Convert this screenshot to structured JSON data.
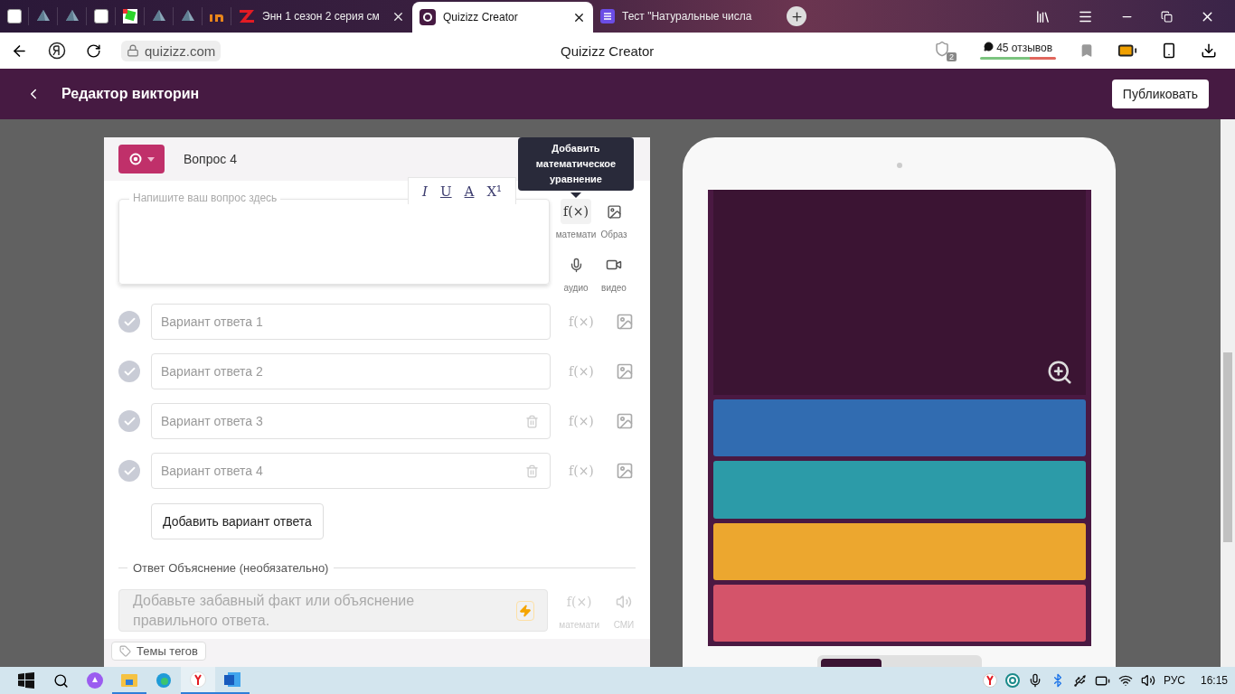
{
  "browser": {
    "tabs": [
      {
        "kind": "page",
        "selected": false
      },
      {
        "kind": "pyramid",
        "selected": false
      },
      {
        "kind": "pyramid",
        "selected": false
      },
      {
        "kind": "page",
        "selected": false
      },
      {
        "kind": "green",
        "selected": false
      },
      {
        "kind": "pyramid",
        "selected": false
      },
      {
        "kind": "pyramid",
        "selected": false
      },
      {
        "kind": "orange",
        "selected": false
      },
      {
        "kind": "site",
        "label": "Энн 1 сезон 2 серия см",
        "selected": false
      },
      {
        "kind": "site",
        "label": "Quizizz Creator",
        "selected": true
      },
      {
        "kind": "site",
        "label": "Тест \"Натуральные числа",
        "selected": false
      }
    ],
    "url": "quizizz.com",
    "page_title": "Quizizz Creator",
    "shield_count": "2",
    "reviews": "45 отзывов"
  },
  "header": {
    "title": "Редактор викторин",
    "publish": "Публиковать"
  },
  "question": {
    "number": "Вопрос 4",
    "tooltip": "Добавить математическое уравнение",
    "format_buttons": [
      "I",
      "U",
      "A",
      "X¹"
    ],
    "placeholder": "Напишите ваш вопрос здесь",
    "media": [
      {
        "kind": "math",
        "glyph": "f(×)",
        "label": "математи"
      },
      {
        "kind": "image",
        "label": "Образ"
      },
      {
        "kind": "audio",
        "label": "аудио"
      },
      {
        "kind": "video",
        "label": "видео"
      }
    ]
  },
  "options": [
    {
      "placeholder": "Вариант ответа 1",
      "correct": false,
      "deletable": false,
      "math_glyph": "f(×)"
    },
    {
      "placeholder": "Вариант ответа 2",
      "correct": false,
      "deletable": false,
      "math_glyph": "f(×)"
    },
    {
      "placeholder": "Вариант ответа 3",
      "correct": false,
      "deletable": true,
      "math_glyph": "f(×)"
    },
    {
      "placeholder": "Вариант ответа 4",
      "correct": false,
      "deletable": true,
      "math_glyph": "f(×)"
    }
  ],
  "add_option": "Добавить вариант ответа",
  "explanation": {
    "heading": "Ответ Объяснение (необязательно)",
    "placeholder": "Добавьте забавный факт или объяснение правильного ответа.",
    "math_glyph": "f(×)",
    "math_label": "математи",
    "media_label": "СМИ"
  },
  "tag_button": "Темы тегов",
  "preview": {
    "answers": [
      {
        "color": "#316cb1"
      },
      {
        "color": "#2c9ba8"
      },
      {
        "color": "#eca72f"
      },
      {
        "color": "#d4546a"
      }
    ]
  },
  "taskbar": {
    "language": "РУС",
    "time": "16:15"
  }
}
